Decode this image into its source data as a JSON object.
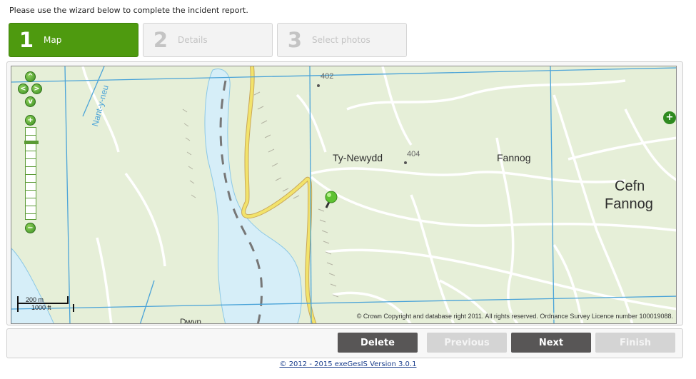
{
  "intro_text": "Please use the wizard below to complete the incident report.",
  "wizard": {
    "steps": [
      {
        "number": "1",
        "label": "Map",
        "state": "active"
      },
      {
        "number": "2",
        "label": "Details",
        "state": "inactive"
      },
      {
        "number": "3",
        "label": "Select photos",
        "state": "inactive"
      }
    ]
  },
  "map": {
    "place_labels": {
      "nant": "Nant-y-neu",
      "elev_402": "402",
      "elev_404": "404",
      "ty_newydd": "Ty-Newydd",
      "fannog": "Fannog",
      "cefn": "Cefn",
      "fannog_large": "Fannog",
      "bottom_partial": "Dwyn"
    },
    "scale": {
      "metric": "200 m",
      "imperial": "1000 ft"
    },
    "copyright": "© Crown Copyright and database right 2011. All rights reserved. Ordnance Survey Licence number 100019088.",
    "controls": {
      "pan_up": "^",
      "pan_left": "<",
      "pan_right": ">",
      "pan_down": "v",
      "zoom_in": "+",
      "zoom_out": "−",
      "layer_switcher": "+"
    },
    "colors": {
      "land": "#e6efd8",
      "water": "#d6eef8",
      "road": "#f2e36b",
      "grid": "#4aa3d8"
    }
  },
  "buttons": {
    "delete": "Delete",
    "previous": "Previous",
    "next": "Next",
    "finish": "Finish"
  },
  "footer": "© 2012 - 2015 exeGesIS Version 3.0.1"
}
